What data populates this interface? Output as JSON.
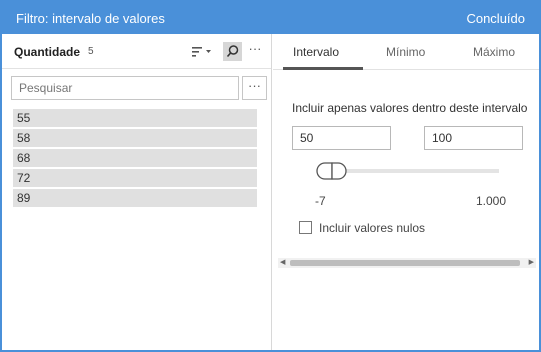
{
  "dialog": {
    "title": "Filtro: intervalo de valores",
    "done_label": "Concluído",
    "accent_color": "#4a90d9"
  },
  "field": {
    "name": "Quantidade",
    "count": "5",
    "icons": [
      "sort-icon",
      "search-icon",
      "more-options-icon"
    ]
  },
  "search": {
    "placeholder": "Pesquisar",
    "value": "",
    "more_label": "···"
  },
  "values": [
    "55",
    "58",
    "68",
    "72",
    "89"
  ],
  "tabs": [
    {
      "label": "Intervalo",
      "active": true
    },
    {
      "label": "Mínimo",
      "active": false
    },
    {
      "label": "Máximo",
      "active": false
    }
  ],
  "range": {
    "label": "Incluir apenas valores dentro deste intervalo",
    "min_value": "50",
    "max_value": "100",
    "domain_min": "-7",
    "domain_max": "1.000"
  },
  "nulls": {
    "label": "Incluir valores nulos",
    "checked": false
  }
}
